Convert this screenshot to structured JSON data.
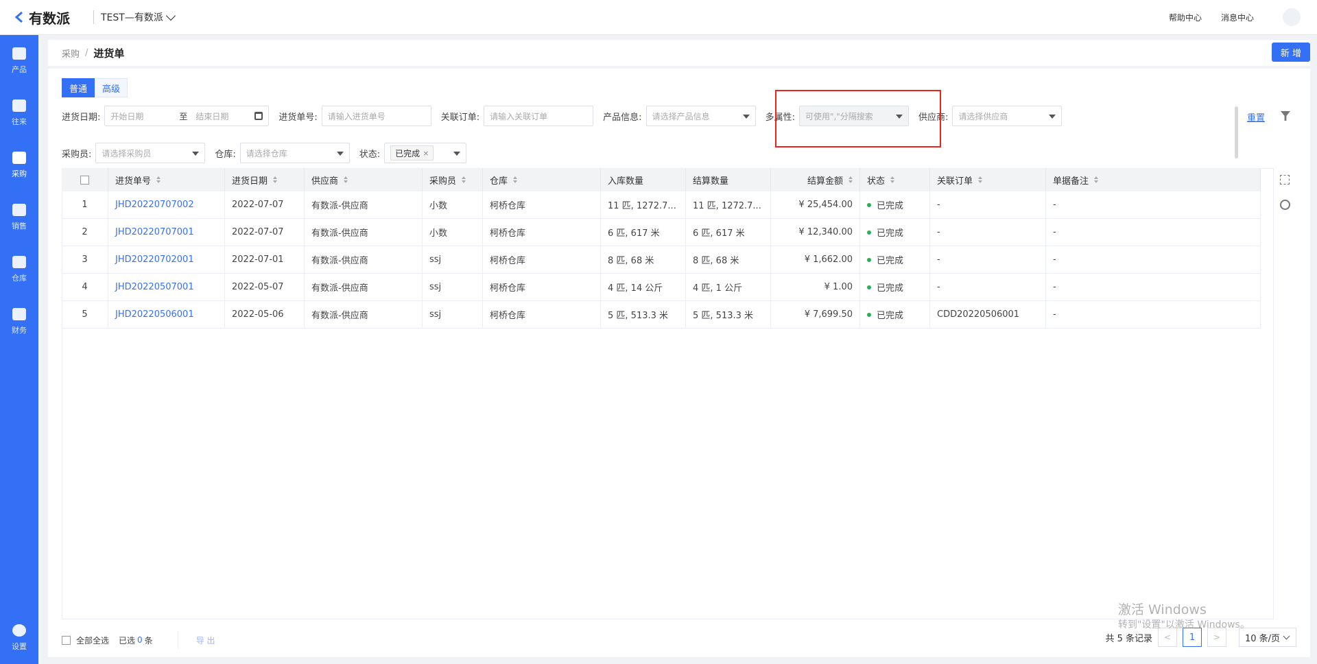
{
  "header": {
    "logo_text": "有数派",
    "org_name": "TEST—有数派",
    "help": "帮助中心",
    "messages": "消息中心"
  },
  "sidebar": {
    "items": [
      {
        "label": "产品",
        "icon": "product-icon"
      },
      {
        "label": "往来",
        "icon": "contact-icon"
      },
      {
        "label": "采购",
        "icon": "purchase-icon"
      },
      {
        "label": "销售",
        "icon": "sales-icon"
      },
      {
        "label": "仓库",
        "icon": "warehouse-icon"
      },
      {
        "label": "财务",
        "icon": "finance-icon"
      }
    ],
    "settings": "设置",
    "active": "采购"
  },
  "breadcrumb": {
    "parent": "采购",
    "separator": "/",
    "current": "进货单"
  },
  "new_button": "新 增",
  "search_mode": {
    "normal": "普通",
    "advanced": "高级"
  },
  "filters": {
    "date_label": "进货日期:",
    "date_start_placeholder": "开始日期",
    "date_to": "至",
    "date_end_placeholder": "结束日期",
    "order_no_label": "进货单号:",
    "order_no_placeholder": "请输入进货单号",
    "related_label": "关联订单:",
    "related_placeholder": "请输入关联订单",
    "product_label": "产品信息:",
    "product_placeholder": "请选择产品信息",
    "multi_attr_label": "多属性:",
    "multi_attr_placeholder": "可使用\",\"分隔搜索",
    "supplier_label": "供应商:",
    "supplier_placeholder": "请选择供应商",
    "buyer_label": "采购员:",
    "buyer_placeholder": "请选择采购员",
    "warehouse_label": "仓库:",
    "warehouse_placeholder": "请选择仓库",
    "status_label": "状态:",
    "status_tag": "已完成",
    "status_tag_close": "×",
    "reset": "重置"
  },
  "table": {
    "columns": [
      "进货单号",
      "进货日期",
      "供应商",
      "采购员",
      "仓库",
      "入库数量",
      "结算数量",
      "结算金额",
      "状态",
      "关联订单",
      "单据备注"
    ],
    "rows": [
      {
        "idx": "1",
        "order_no": "JHD20220707002",
        "date": "2022-07-07",
        "supplier": "有数派-供应商",
        "buyer": "小数",
        "warehouse": "柯桥仓库",
        "in_qty": "11 匹, 1272.7...",
        "settle_qty": "11 匹, 1272.7...",
        "amount": "¥ 25,454.00",
        "status": "已完成",
        "related": "-",
        "remark": "-"
      },
      {
        "idx": "2",
        "order_no": "JHD20220707001",
        "date": "2022-07-07",
        "supplier": "有数派-供应商",
        "buyer": "小数",
        "warehouse": "柯桥仓库",
        "in_qty": "6 匹, 617 米",
        "settle_qty": "6 匹, 617 米",
        "amount": "¥ 12,340.00",
        "status": "已完成",
        "related": "-",
        "remark": "-"
      },
      {
        "idx": "3",
        "order_no": "JHD20220702001",
        "date": "2022-07-01",
        "supplier": "有数派-供应商",
        "buyer": "ssj",
        "warehouse": "柯桥仓库",
        "in_qty": "8 匹, 68 米",
        "settle_qty": "8 匹, 68 米",
        "amount": "¥ 1,662.00",
        "status": "已完成",
        "related": "-",
        "remark": "-"
      },
      {
        "idx": "4",
        "order_no": "JHD20220507001",
        "date": "2022-05-07",
        "supplier": "有数派-供应商",
        "buyer": "ssj",
        "warehouse": "柯桥仓库",
        "in_qty": "4 匹, 14 公斤",
        "settle_qty": "4 匹, 1 公斤",
        "amount": "¥ 1.00",
        "status": "已完成",
        "related": "-",
        "remark": "-"
      },
      {
        "idx": "5",
        "order_no": "JHD20220506001",
        "date": "2022-05-06",
        "supplier": "有数派-供应商",
        "buyer": "ssj",
        "warehouse": "柯桥仓库",
        "in_qty": "5 匹, 513.3 米",
        "settle_qty": "5 匹, 513.3 米",
        "amount": "¥ 7,699.50",
        "status": "已完成",
        "related": "CDD20220506001",
        "remark": "-"
      }
    ]
  },
  "footer": {
    "select_all": "全部全选",
    "selected_prefix": "已选",
    "selected_count": "0",
    "selected_suffix": "条",
    "export": "导 出",
    "total": "共 5 条记录",
    "prev": "<",
    "page": "1",
    "next": ">",
    "page_size": "10 条/页"
  },
  "watermark": {
    "line1": "激活 Windows",
    "line2": "转到\"设置\"以激活 Windows。"
  }
}
